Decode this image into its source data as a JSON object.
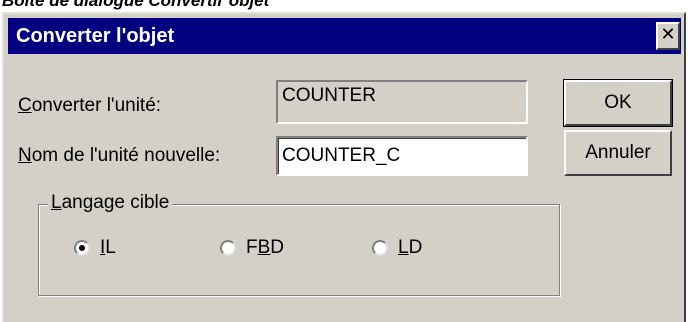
{
  "caption": "Boîte de dialogue Convertir objet",
  "dialog": {
    "title": "Converter l'objet",
    "close_glyph": "✕",
    "close_icon": "close-icon"
  },
  "fields": {
    "convert_unit_label_accel": "C",
    "convert_unit_label_rest": "onverter l'unité:",
    "convert_unit_value": "COUNTER",
    "new_unit_label_accel": "N",
    "new_unit_label_rest": "om de l'unité nouvelle:",
    "new_unit_value": "COUNTER_C"
  },
  "buttons": {
    "ok": "OK",
    "cancel": "Annuler"
  },
  "target_language": {
    "group_title_accel": "L",
    "group_title_rest": "angage cible",
    "options": [
      {
        "label_before": "",
        "label_accel": "I",
        "label_after": "L",
        "selected": true
      },
      {
        "label_before": "F",
        "label_accel": "B",
        "label_after": "D",
        "selected": false
      },
      {
        "label_before": "",
        "label_accel": "L",
        "label_after": "D",
        "selected": false
      }
    ]
  },
  "colors": {
    "titlebar": "#000080",
    "face": "#d4d0c8"
  }
}
